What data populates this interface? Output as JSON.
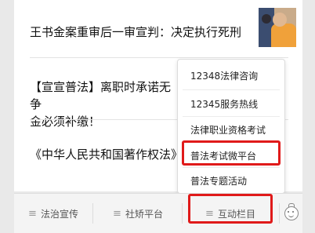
{
  "news": [
    {
      "title": "王书金案重审后一审宣判：决定执行死刑"
    },
    {
      "title_line1": "【宣宣普法】离职时承诺无争",
      "title_line2": "金必须补缴！"
    },
    {
      "title": "《中华人民共和国著作权法》"
    }
  ],
  "menu": {
    "items": [
      {
        "label": "12348法律咨询"
      },
      {
        "label": "12345服务热线"
      },
      {
        "label": "法律职业资格考试"
      },
      {
        "label": "普法考试微平台"
      },
      {
        "label": "普法专题活动"
      }
    ],
    "highlighted_index": 3
  },
  "tabbar": {
    "tabs": [
      {
        "label": "法治宣传",
        "icon": "hamburger-icon"
      },
      {
        "label": "社矫平台",
        "icon": "hamburger-icon"
      },
      {
        "label": "互动栏目",
        "icon": "hamburger-icon"
      }
    ],
    "highlighted_index": 2,
    "extra_icon": "robot-face-icon"
  },
  "colors": {
    "highlight": "#e01a1a",
    "background": "#e9e9e9"
  }
}
